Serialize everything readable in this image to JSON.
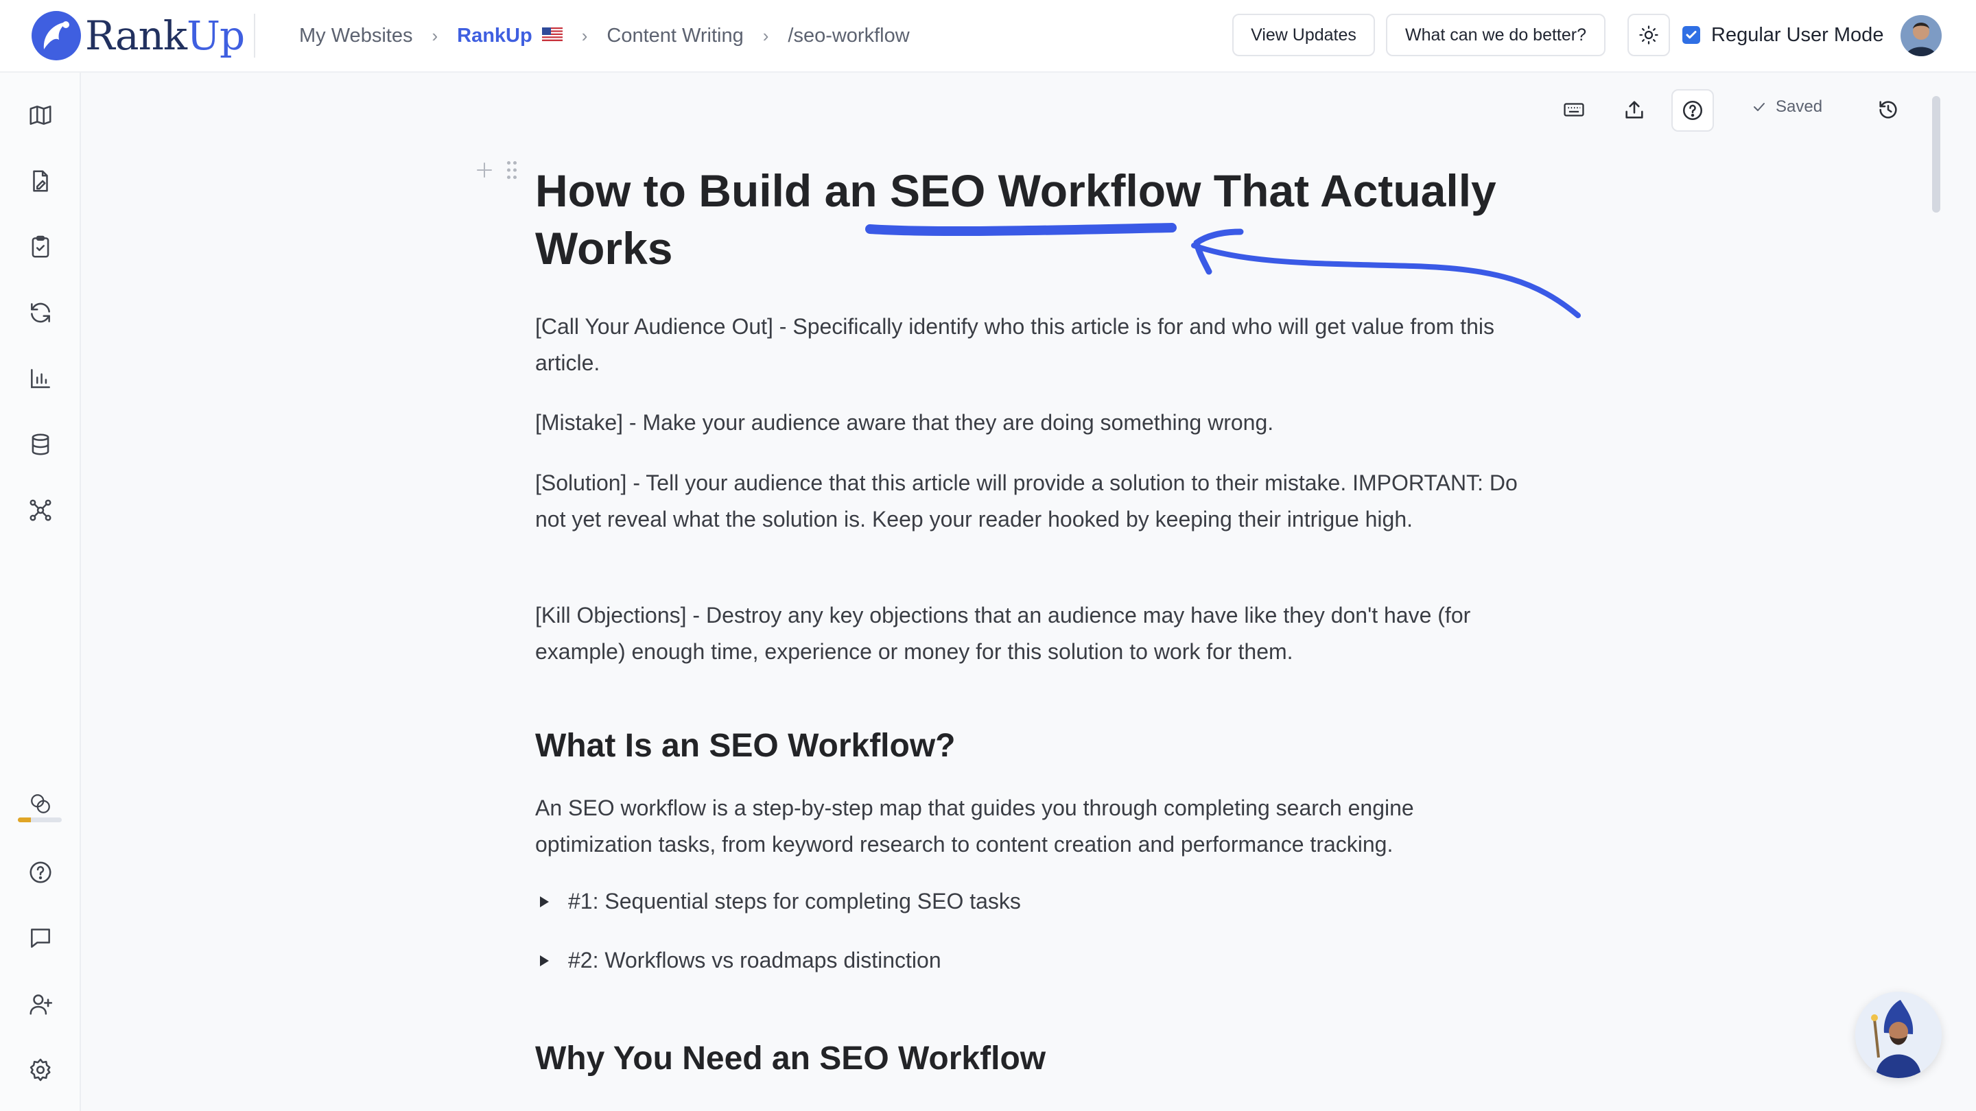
{
  "app": {
    "brand_rank": "Rank",
    "brand_up": "Up",
    "accent_color": "#3f5fe0"
  },
  "breadcrumb": {
    "items": [
      "My Websites",
      "RankUp",
      "Content Writing",
      "/seo-workflow"
    ],
    "flag_icon": "us-flag-icon"
  },
  "header": {
    "view_updates": "View Updates",
    "feedback": "What can we do better?",
    "mode_label": "Regular User Mode",
    "mode_checked": true
  },
  "sidebar": {
    "icons": [
      "map-icon",
      "document-edit-icon",
      "clipboard-check-icon",
      "refresh-icon",
      "bar-chart-icon",
      "database-icon",
      "network-icon"
    ],
    "bottom_icons": [
      "credits-icon",
      "help-icon",
      "chat-icon",
      "add-user-icon",
      "settings-icon"
    ],
    "credits_fraction": 0.3
  },
  "toolbar": {
    "saved_label": "Saved"
  },
  "document": {
    "title_before": "How to Build an ",
    "title_highlight": "SEO Workflow",
    "title_after": " That Actually Works",
    "paragraphs": [
      "[Call Your Audience Out] - Specifically identify who this article is for and who will get value from this article.",
      "[Mistake] - Make your audience aware that they are doing something wrong.",
      "[Solution] - Tell your audience that this article will provide a solution to their mistake. IMPORTANT: Do not yet reveal what the solution is. Keep your reader hooked by keeping their intrigue high.",
      "[Kill Objections] - Destroy any key objections that an audience may have like they don't have (for example) enough time, experience or money for this solution to work for them."
    ],
    "section1_heading": "What Is an SEO Workflow?",
    "section1_text": "An SEO workflow is a step-by-step map that guides you through completing search engine optimization tasks, from keyword research to content creation and performance tracking.",
    "toggles": [
      "#1: Sequential steps for completing SEO tasks",
      "#2: Workflows vs roadmaps distinction"
    ],
    "section2_heading": "Why You Need an SEO Workflow"
  }
}
